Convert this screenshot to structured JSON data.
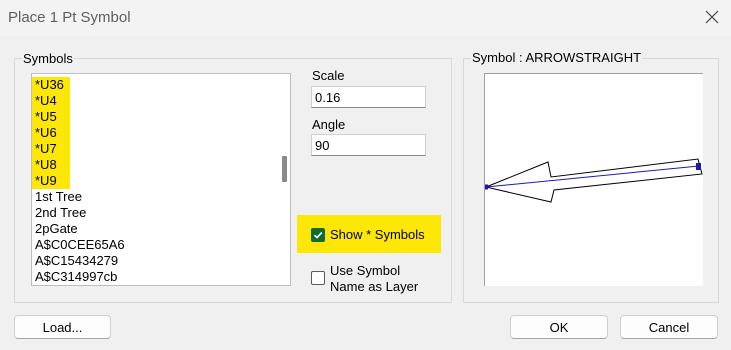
{
  "window": {
    "title": "Place 1 Pt Symbol"
  },
  "symbols": {
    "group_label": "Symbols",
    "items": [
      {
        "label": "*U36",
        "highlighted": true
      },
      {
        "label": "*U4",
        "highlighted": true
      },
      {
        "label": "*U5",
        "highlighted": true
      },
      {
        "label": "*U6",
        "highlighted": true
      },
      {
        "label": "*U7",
        "highlighted": true
      },
      {
        "label": "*U8",
        "highlighted": true
      },
      {
        "label": "*U9",
        "highlighted": true
      },
      {
        "label": "1st Tree",
        "highlighted": false
      },
      {
        "label": "2nd Tree",
        "highlighted": false
      },
      {
        "label": "2pGate",
        "highlighted": false
      },
      {
        "label": "A$C0CEE65A6",
        "highlighted": false
      },
      {
        "label": "A$C15434279",
        "highlighted": false
      },
      {
        "label": "A$C314997cb",
        "highlighted": false
      }
    ]
  },
  "scale": {
    "label": "Scale",
    "value": "0.16"
  },
  "angle": {
    "label": "Angle",
    "value": "90"
  },
  "show_symbols": {
    "label": "Show * Symbols",
    "checked": true
  },
  "use_symbol_name": {
    "label_line1": "Use Symbol",
    "label_line2": "Name as Layer",
    "checked": false
  },
  "preview": {
    "group_label": "Symbol : ARROWSTRAIGHT",
    "symbol_name": "ARROWSTRAIGHT"
  },
  "buttons": {
    "load": "Load...",
    "ok": "OK",
    "cancel": "Cancel"
  },
  "colors": {
    "highlight": "#fde706",
    "checkbox_checked": "#0f6b2f",
    "symbol_line": "#1a1ab0"
  }
}
